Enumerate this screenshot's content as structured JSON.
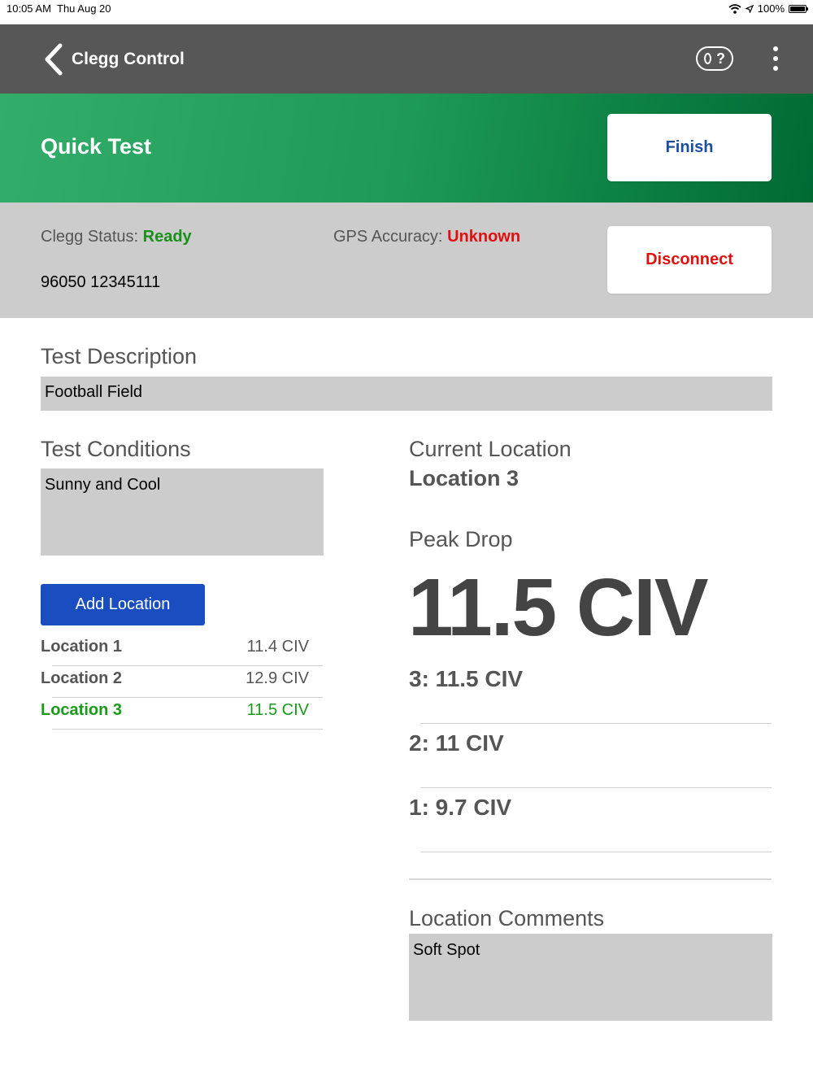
{
  "status_bar": {
    "time": "10:05 AM",
    "date": "Thu Aug 20",
    "battery": "100%"
  },
  "nav": {
    "title": "Clegg Control",
    "help_label": "?"
  },
  "header": {
    "title": "Quick Test",
    "finish_label": "Finish",
    "bg_start": "#33ad6b",
    "bg_end": "#006a35"
  },
  "device": {
    "clegg_status_label": "Clegg Status: ",
    "clegg_status_value": "Ready",
    "gps_label": "GPS Accuracy: ",
    "gps_value": "Unknown",
    "serial": "96050 12345111",
    "disconnect_label": "Disconnect"
  },
  "test_description": {
    "label": "Test Description",
    "value": "Football Field"
  },
  "test_conditions": {
    "label": "Test Conditions",
    "value": "Sunny and Cool"
  },
  "add_location_label": "Add Location",
  "locations": [
    {
      "name": "Location 1",
      "value": "11.4 CIV"
    },
    {
      "name": "Location 2",
      "value": "12.9 CIV"
    },
    {
      "name": "Location 3",
      "value": "11.5 CIV"
    }
  ],
  "current_location": {
    "label": "Current Location",
    "value": "Location 3"
  },
  "peak_drop": {
    "label": "Peak Drop",
    "value": "11.5 CIV"
  },
  "drops": [
    "3: 11.5 CIV",
    "2: 11 CIV",
    "1: 9.7 CIV"
  ],
  "location_comments": {
    "label": "Location Comments",
    "value": "Soft Spot"
  },
  "colors": {
    "accent_blue": "#1a4dbf",
    "ok_green": "#1a8f1a",
    "error_red": "#e01010",
    "nav_gray": "#575757"
  }
}
